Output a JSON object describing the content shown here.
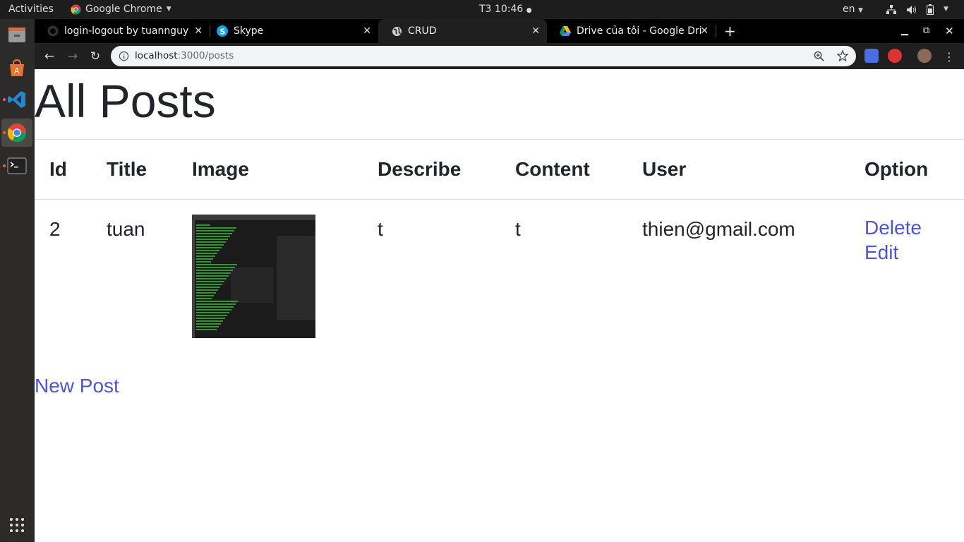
{
  "topbar": {
    "activities": "Activities",
    "app_name": "Google Chrome",
    "clock": "T3 10:46",
    "lang": "en"
  },
  "dock": {
    "items": [
      "files-icon",
      "software-center-icon",
      "vscode-icon",
      "chrome-icon",
      "terminal-icon",
      "apps-grid-icon"
    ]
  },
  "tabs": [
    {
      "title": "login-logout by tuannguy",
      "icon": "github-icon"
    },
    {
      "title": "Skype",
      "icon": "skype-icon"
    },
    {
      "title": "CRUD",
      "icon": "globe-icon"
    },
    {
      "title": "Drive của tôi - Google Driv",
      "icon": "google-drive-icon"
    }
  ],
  "toolbar": {
    "url_host": "localhost",
    "url_path": ":3000/posts",
    "url_full": "localhost:3000/posts"
  },
  "colors": {
    "link": "#4e52e0",
    "text": "#212529",
    "accent_dot": "#e8623a"
  },
  "page": {
    "heading": "All Posts",
    "columns": [
      "Id",
      "Title",
      "Image",
      "Describe",
      "Content",
      "User",
      "Option"
    ],
    "rows": [
      {
        "id": "2",
        "title": "tuan",
        "describe": "t",
        "content": "t",
        "user": "thien@gmail.com",
        "delete_label": "Delete",
        "edit_label": "Edit"
      }
    ],
    "new_post_label": "New Post"
  }
}
